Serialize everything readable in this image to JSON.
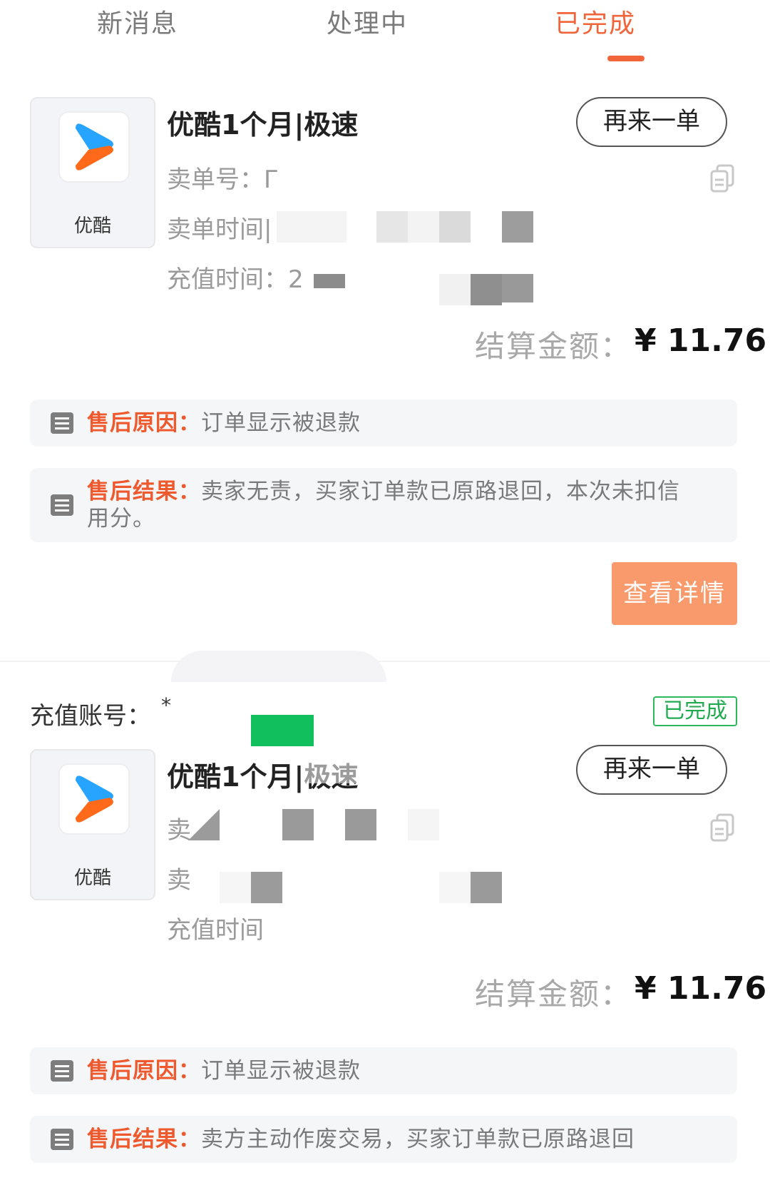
{
  "tabs": {
    "items": [
      {
        "label": "新消息"
      },
      {
        "label": "处理中"
      },
      {
        "label": "已完成"
      }
    ],
    "active_index": 2
  },
  "colors": {
    "accent": "#f2653a",
    "detail_button": "#f89a6b",
    "success": "#2eb85c"
  },
  "orders": [
    {
      "brand": "优酷",
      "product_title": "优酷1个月|极速",
      "reorder_label": "再来一单",
      "sell_no_text": "卖单号：Γ",
      "sell_time_text": "卖单时间|",
      "recharge_time_text": "充值时间：2",
      "amount_label": "结算金额：",
      "amount_value": "¥ 11.76",
      "reason_key": "售后原因：",
      "reason_text": "订单显示被退款",
      "result_key": "售后结果：",
      "result_text": "卖家无责，买家订单款已原路退回，本次未扣信用分。",
      "detail_label": "查看详情"
    },
    {
      "account_label": "充值账号：",
      "account_masked": "*",
      "status": "已完成",
      "brand": "优酷",
      "product_title": "优酷1个月|极速",
      "reorder_label": "再来一单",
      "sell_no_text": "卖",
      "sell_time_text": "卖",
      "recharge_time_text": "充值时间",
      "amount_label": "结算金额：",
      "amount_value": "¥ 11.76",
      "reason_key": "售后原因：",
      "reason_text": "订单显示被退款",
      "result_key": "售后结果：",
      "result_text": "卖方主动作废交易，买家订单款已原路退回"
    }
  ]
}
